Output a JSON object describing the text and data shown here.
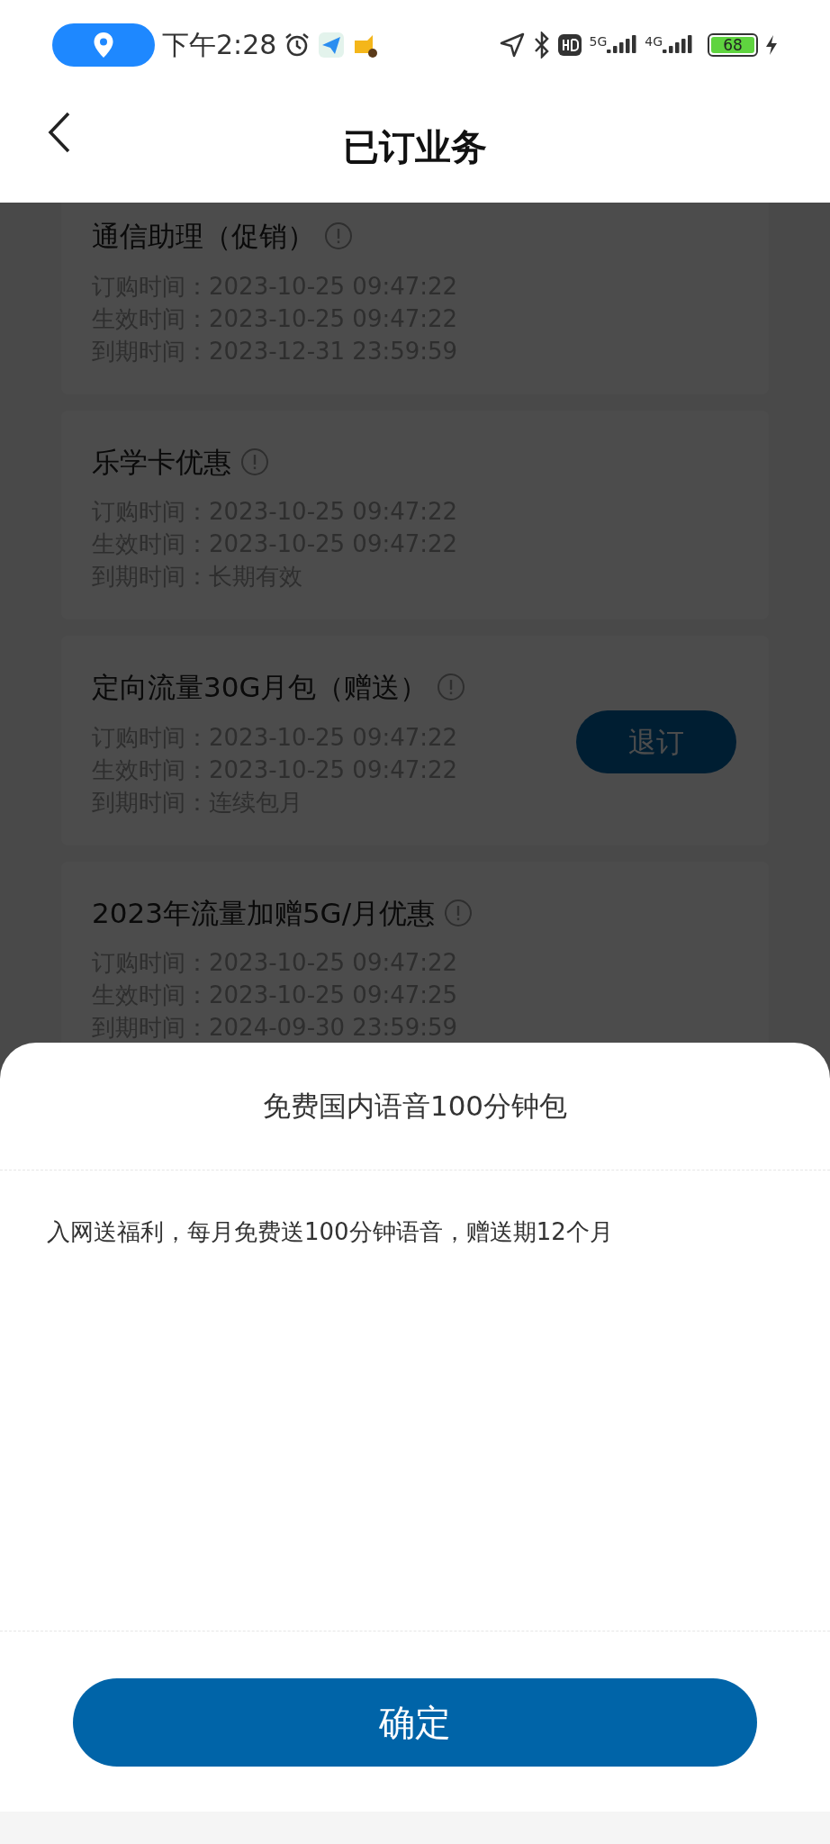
{
  "status_bar": {
    "time": "下午2:28",
    "network_1": "5G",
    "network_2": "4G",
    "battery": "68"
  },
  "header": {
    "title": "已订业务"
  },
  "services": [
    {
      "name": "通信助理（促销）",
      "details": [
        {
          "label": "订购时间：",
          "value": "2023-10-25 09:47:22"
        },
        {
          "label": "生效时间：",
          "value": "2023-10-25 09:47:22"
        },
        {
          "label": "到期时间：",
          "value": "2023-12-31 23:59:59"
        }
      ]
    },
    {
      "name": "乐学卡优惠",
      "details": [
        {
          "label": "订购时间：",
          "value": "2023-10-25 09:47:22"
        },
        {
          "label": "生效时间：",
          "value": "2023-10-25 09:47:22"
        },
        {
          "label": "到期时间：",
          "value": "长期有效"
        }
      ]
    },
    {
      "name": "定向流量30G月包（赠送）",
      "action": "退订",
      "details": [
        {
          "label": "订购时间：",
          "value": "2023-10-25 09:47:22"
        },
        {
          "label": "生效时间：",
          "value": "2023-10-25 09:47:22"
        },
        {
          "label": "到期时间：",
          "value": "连续包月"
        }
      ]
    },
    {
      "name": "2023年流量加赠5G/月优惠",
      "details": [
        {
          "label": "订购时间：",
          "value": "2023-10-25 09:47:22"
        },
        {
          "label": "生效时间：",
          "value": "2023-10-25 09:47:25"
        },
        {
          "label": "到期时间：",
          "value": "2024-09-30 23:59:59"
        }
      ]
    }
  ],
  "sheet": {
    "title": "免费国内语音100分钟包",
    "description": "入网送福利，每月免费送100分钟语音，赠送期12个月",
    "confirm": "确定"
  }
}
